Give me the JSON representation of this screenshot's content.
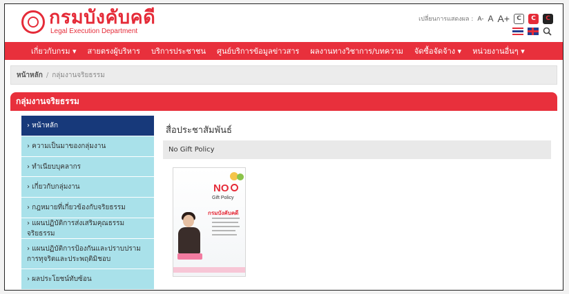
{
  "header": {
    "logo_title": "กรมบังคับคดี",
    "logo_subtitle": "Legal Execution Department",
    "display_label": "เปลี่ยนการแสดงผล :",
    "font_small": "A-",
    "font_normal": "A",
    "font_large": "A+",
    "contrast_1": "C",
    "contrast_2": "C",
    "contrast_3": "C"
  },
  "nav": {
    "items": [
      "เกี่ยวกับกรม ▾",
      "สายตรงผู้บริหาร",
      "บริการประชาชน",
      "ศูนย์บริการข้อมูลข่าวสาร",
      "ผลงานทางวิชาการ/บทความ",
      "จัดซื้อจัดจ้าง ▾",
      "หน่วยงานอื่นๆ ▾"
    ]
  },
  "breadcrumb": {
    "home": "หน้าหลัก",
    "separator": "/",
    "current": "กลุ่มงานจริยธรรม"
  },
  "section": {
    "title": "กลุ่มงานจริยธรรม"
  },
  "sidebar": {
    "items": [
      "› หน้าหลัก",
      "› ความเป็นมาของกลุ่มงาน",
      "› ทำเนียบบุคลากร",
      "› เกี่ยวกับกลุ่มงาน",
      "› กฎหมายที่เกี่ยวข้องกับจริยธรรม",
      "› แผนปฏิบัติการส่งเสริมคุณธรรม จริยธรรม",
      "› แผนปฏิบัติการป้องกันและปราบปรามการทุจริตและประพฤติมิชอบ",
      "› ผลประโยชน์ทับซ้อน"
    ],
    "active_index": 0
  },
  "main": {
    "title": "สื่อประชาสัมพันธ์",
    "policy_label": "No Gift Policy"
  },
  "poster": {
    "no_text": "NO",
    "gift_line1": "Gift Policy",
    "brand": "กรมบังคับคดี"
  },
  "colors": {
    "brand_red": "#e8303c",
    "sidebar_bg": "#a9e1ea",
    "sidebar_active": "#17397a"
  }
}
